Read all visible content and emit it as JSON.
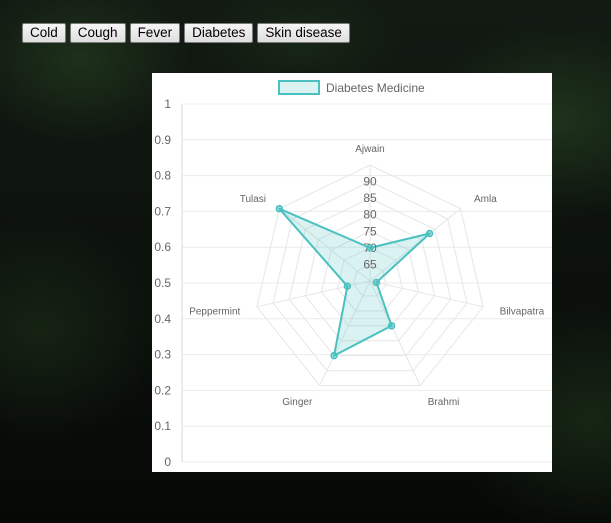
{
  "buttons": [
    "Cold",
    "Cough",
    "Fever",
    "Diabetes",
    "Skin disease"
  ],
  "colors": {
    "accent": "#4bc0c0",
    "fill": "rgba(75,192,192,0.2)",
    "grid": "#e6e6e6"
  },
  "chart_data": {
    "type": "radar",
    "categories": [
      "Ajwain",
      "Amla",
      "Bilvapatra",
      "Brahmi",
      "Ginger",
      "Peppermint",
      "Tulasi"
    ],
    "series": [
      {
        "name": "Diabetes Medicine",
        "values": [
          70,
          83,
          62,
          75,
          85,
          67,
          95
        ]
      }
    ],
    "r_ticks": [
      65,
      70,
      75,
      80,
      85,
      90
    ],
    "r_range": [
      60,
      95
    ],
    "y_ticks": [
      "0",
      "0.1",
      "0.2",
      "0.3",
      "0.4",
      "0.5",
      "0.6",
      "0.7",
      "0.8",
      "0.9",
      "1"
    ],
    "ylim": [
      0,
      1
    ],
    "legend": "top"
  }
}
